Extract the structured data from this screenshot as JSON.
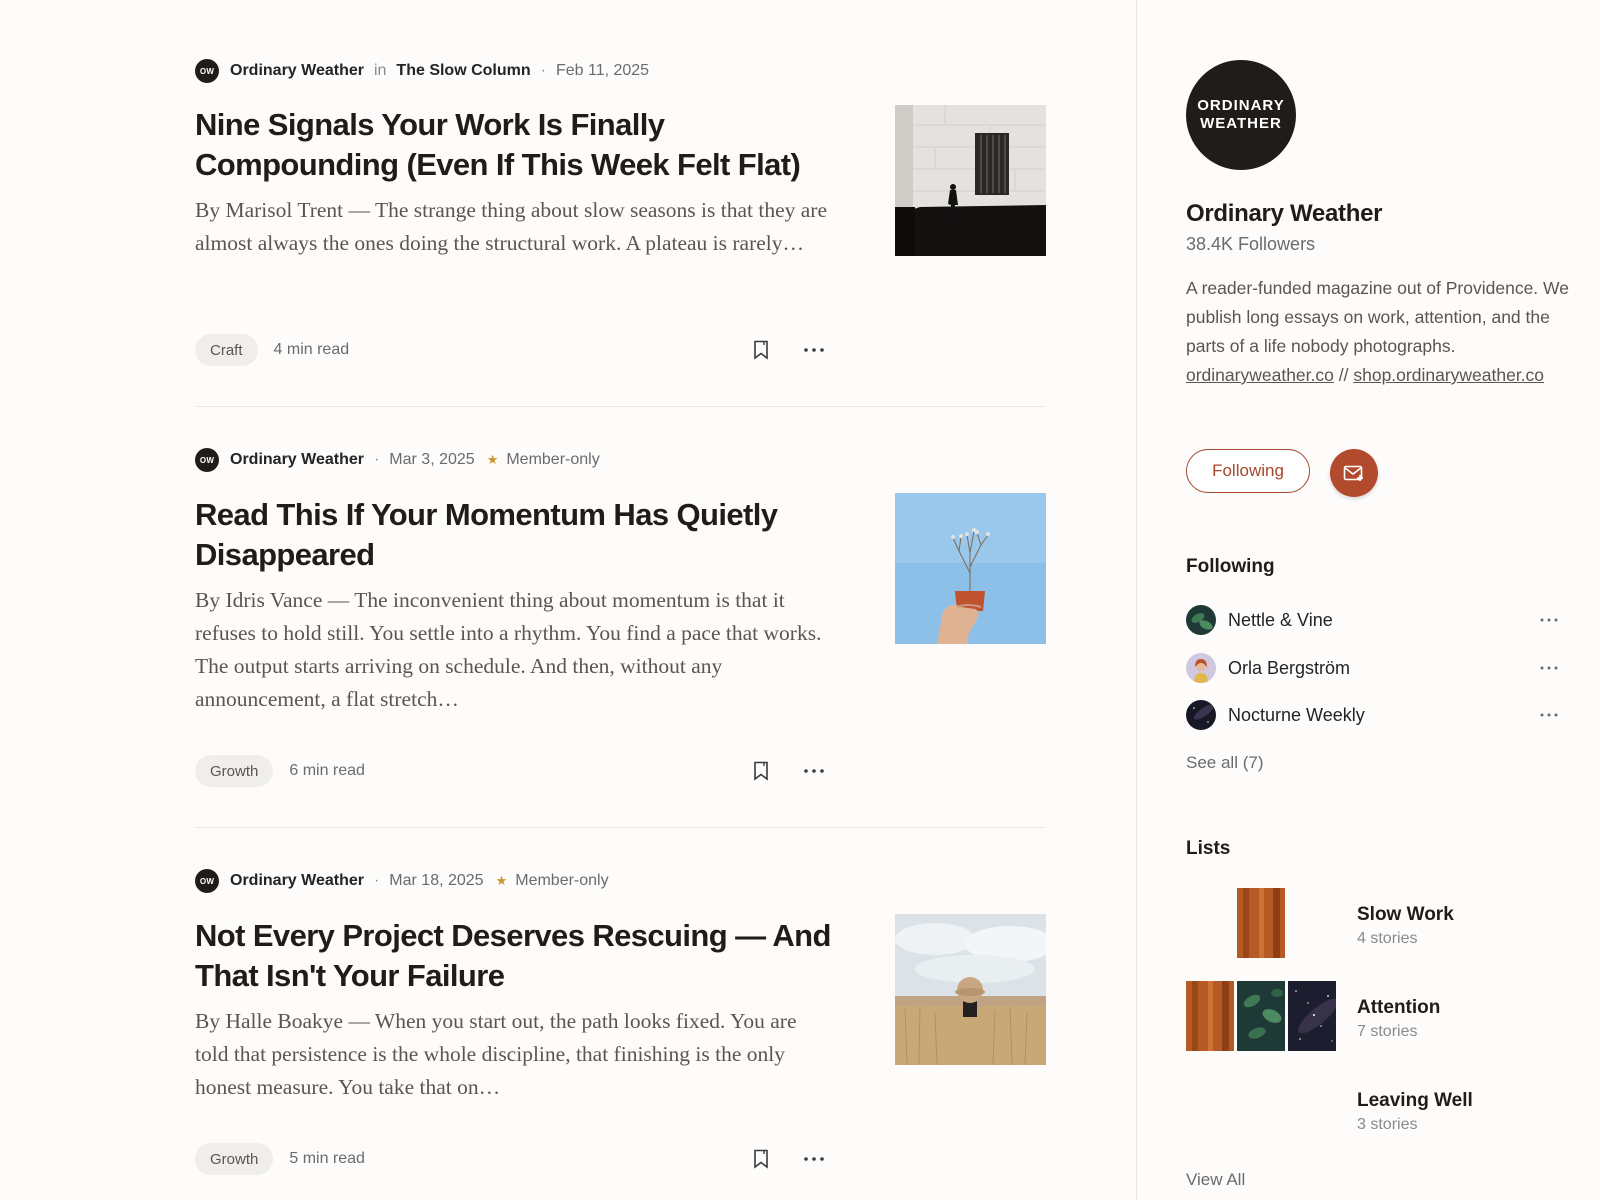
{
  "articles": [
    {
      "publication_logo": "OW",
      "publication": "Ordinary Weather",
      "in_word": "in",
      "collection": "The Slow Column",
      "separator": "·",
      "date": "Feb 11, 2025",
      "member_only": "",
      "title": "Nine Signals Your Work Is Finally Compounding (Even If This Week Felt Flat)",
      "excerpt": "By Marisol Trent — The strange thing about slow seasons is that they are almost always the ones doing the structural work. A plateau is rarely…",
      "tag": "Craft",
      "read_time": "4 min read",
      "thumbnail": "window-silhouette-photo"
    },
    {
      "publication_logo": "OW",
      "publication": "Ordinary Weather",
      "separator": "·",
      "date": "Mar 3, 2025",
      "star": "★",
      "member_only": "Member-only",
      "title": "Read This If Your Momentum Has Quietly Disappeared",
      "excerpt": "By Idris Vance — The inconvenient thing about momentum is that it refuses to hold still. You settle into a rhythm. You find a pace that works. The output starts arriving on schedule. And then, without any announcement, a flat stretch…",
      "tag": "Growth",
      "read_time": "6 min read",
      "thumbnail": "hand-with-plant-sky-photo"
    },
    {
      "publication_logo": "OW",
      "publication": "Ordinary Weather",
      "separator": "·",
      "date": "Mar 18, 2025",
      "star": "★",
      "member_only": "Member-only",
      "title": "Not Every Project Deserves Rescuing — And That Isn't Your Failure",
      "excerpt": "By Halle Boakye — When you start out, the path looks fixed. You are told that persistence is the whole discipline, that finishing is the only honest measure. You take that on…",
      "tag": "Growth",
      "read_time": "5 min read",
      "thumbnail": "wheat-field-hat-photo"
    }
  ],
  "sidebar": {
    "logo_line1": "ORDINARY",
    "logo_line2": "WEATHER",
    "title": "Ordinary Weather",
    "followers": "38.4K Followers",
    "description": "A reader-funded magazine out of Providence. We publish long essays on work, attention, and the parts of a life nobody photographs.",
    "link1": "ordinaryweather.co",
    "link_sep": "//",
    "link2": "shop.ordinaryweather.co",
    "follow_label": "Following",
    "subscribe_icon": "mail-plus-icon",
    "following_heading": "Following",
    "following": [
      {
        "name": "Nettle & Vine",
        "avatar": "leaf-avatar"
      },
      {
        "name": "Orla Bergström",
        "avatar": "person-avatar"
      },
      {
        "name": "Nocturne Weekly",
        "avatar": "night-sky-avatar"
      }
    ],
    "see_all": "See all (7)",
    "lists_heading": "Lists",
    "lists": [
      {
        "name": "Slow Work",
        "count": "4 stories"
      },
      {
        "name": "Attention",
        "count": "7 stories"
      },
      {
        "name": "Leaving Well",
        "count": "3 stories"
      }
    ],
    "view_all": "View All"
  },
  "colors": {
    "accent": "#b24a2d",
    "star": "#c9952d",
    "text": "#242424",
    "muted": "#6b6b6b"
  }
}
